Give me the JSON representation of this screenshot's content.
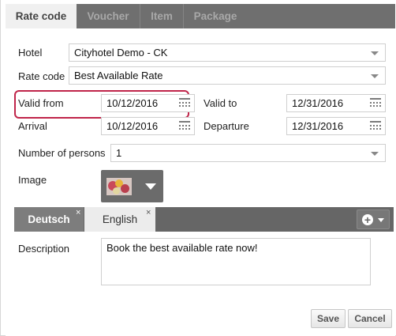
{
  "tabs": [
    {
      "label": "Rate code",
      "active": true
    },
    {
      "label": "Voucher",
      "active": false
    },
    {
      "label": "Item",
      "active": false
    },
    {
      "label": "Package",
      "active": false
    }
  ],
  "form": {
    "hotel_label": "Hotel",
    "hotel_value": "Cityhotel Demo - CK",
    "rate_code_label": "Rate code",
    "rate_code_value": "Best Available Rate",
    "valid_from_label": "Valid from",
    "valid_from_value": "10/12/2016",
    "valid_to_label": "Valid to",
    "valid_to_value": "12/31/2016",
    "arrival_label": "Arrival",
    "arrival_value": "10/12/2016",
    "departure_label": "Departure",
    "departure_value": "12/31/2016",
    "persons_label": "Number of persons",
    "persons_value": "1",
    "image_label": "Image",
    "description_label": "Description",
    "description_value": "Book the best available rate now!"
  },
  "languages": [
    {
      "label": "Deutsch",
      "active": false
    },
    {
      "label": "English",
      "active": true
    }
  ],
  "lang_close_glyph": "×",
  "add_language_icon": "plus-circle-icon",
  "buttons": {
    "save": "Save",
    "cancel": "Cancel"
  },
  "colors": {
    "highlight": "#c0254a",
    "tab_bar": "#6f6f6f"
  }
}
